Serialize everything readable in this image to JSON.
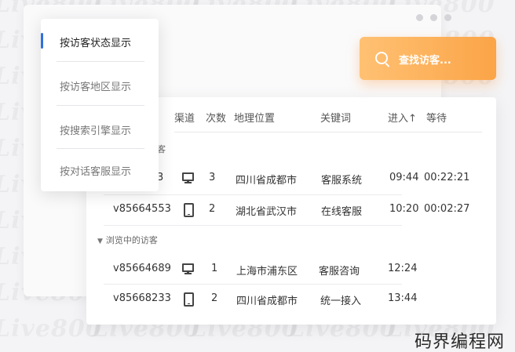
{
  "watermark": "Live800",
  "menu": {
    "items": [
      {
        "label": "按访客状态显示",
        "active": true
      },
      {
        "label": "按访客地区显示",
        "active": false
      },
      {
        "label": "按搜索引擎显示",
        "active": false
      },
      {
        "label": "按对话客服显示",
        "active": false
      }
    ]
  },
  "search": {
    "label": "查找访客..."
  },
  "table": {
    "headers": {
      "channel": "渠道",
      "count": "次数",
      "location": "地理位置",
      "keyword": "关键词",
      "enter": "进入↑",
      "wait": "等待"
    },
    "groups": [
      {
        "label": "客",
        "rows": [
          {
            "id": "3",
            "device": "pc",
            "count": "3",
            "location": "四川省成都市",
            "keyword": "客服系统",
            "enter": "09:44",
            "wait": "00:22:21"
          },
          {
            "id": "v85664553",
            "device": "phone",
            "count": "2",
            "location": "湖北省武汉市",
            "keyword": "在线客服",
            "enter": "10:20",
            "wait": "00:02:27"
          }
        ]
      },
      {
        "label": "浏览中的访客",
        "rows": [
          {
            "id": "v85664689",
            "device": "pc",
            "count": "1",
            "location": "上海市浦东区",
            "keyword": "客服咨询",
            "enter": "12:24",
            "wait": ""
          },
          {
            "id": "v85668233",
            "device": "phone",
            "count": "2",
            "location": "四川省成都市",
            "keyword": "统一接入",
            "enter": "13:44",
            "wait": ""
          }
        ]
      }
    ]
  },
  "corner_mark": "码界编程网"
}
